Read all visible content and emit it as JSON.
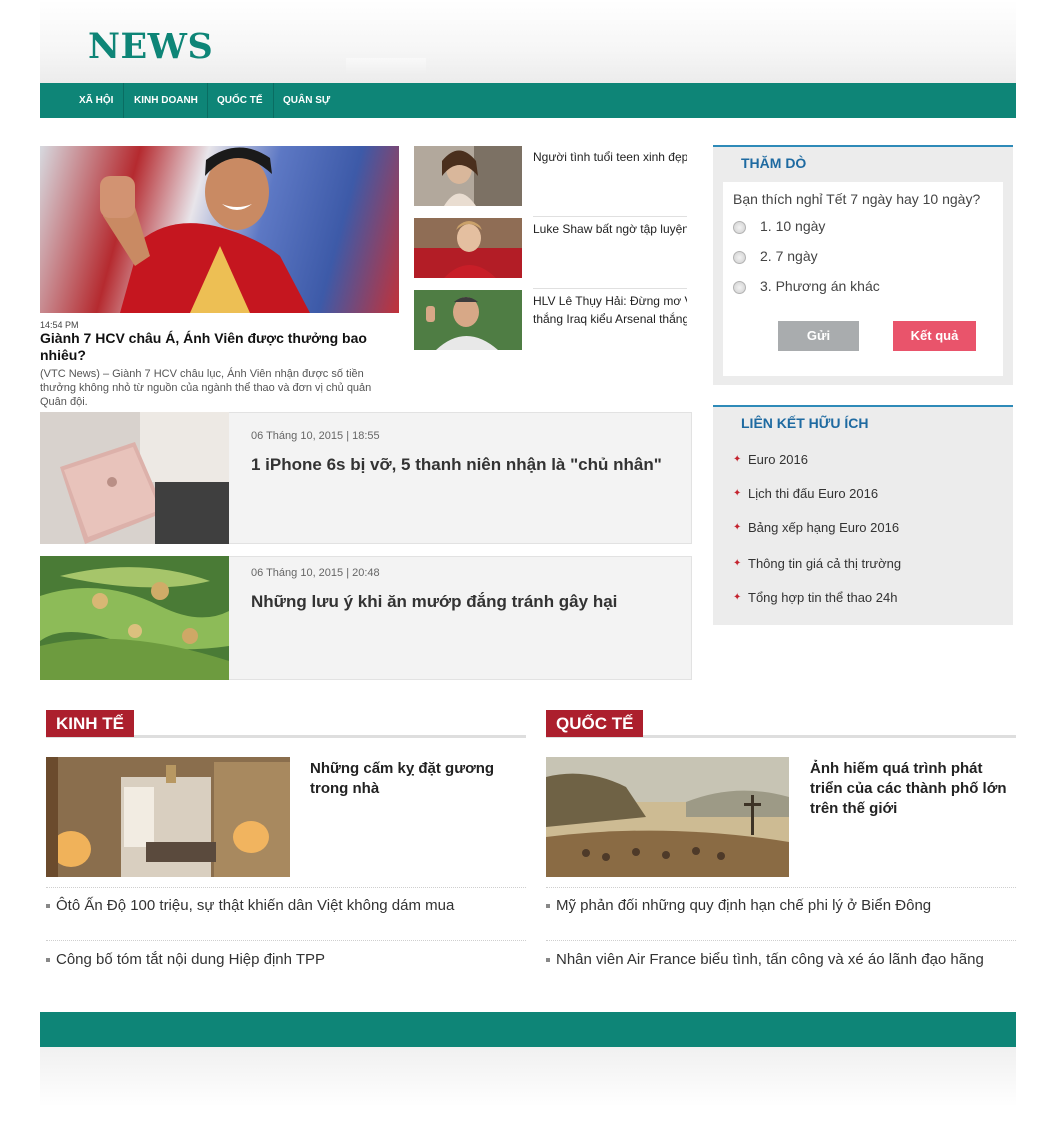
{
  "header": {
    "logo": "NEWS"
  },
  "nav": {
    "items": [
      "Xã hội",
      "Kinh doanh",
      "Quốc tế",
      "Quân sự"
    ]
  },
  "featured": {
    "time": "14:54 PM",
    "title": "Giành 7 HCV châu Á, Ánh Viên được thưởng bao nhiêu?",
    "description": "(VTC News) – Giành 7 HCV châu lục, Ánh Viên nhận được số tiền thưởng không nhỏ từ nguồn của ngành thể thao và đơn vị chủ quản Quân đội."
  },
  "side_stories": [
    {
      "title": "Người tình tuổi teen xinh đẹp"
    },
    {
      "title": "Luke Shaw bất ngờ tập luyện"
    },
    {
      "title": "HLV Lê Thụy Hải: Đừng mơ V",
      "title2": "thắng Iraq kiểu Arsenal thắng"
    }
  ],
  "list_cards": [
    {
      "meta": "06 Tháng 10, 2015 | 18:55",
      "title": "1 iPhone 6s bị vỡ, 5 thanh niên nhận là \"chủ nhân\""
    },
    {
      "meta": "06 Tháng 10, 2015 | 20:48",
      "title": "Những lưu ý khi ăn mướp đắng tránh gây hại"
    }
  ],
  "poll": {
    "heading": "Thăm dò",
    "question": "Bạn thích nghỉ Tết 7 ngày hay 10 ngày?",
    "options": [
      "1. 10 ngày",
      "2. 7 ngày",
      "3. Phương án khác"
    ],
    "submit_label": "Gửi",
    "result_label": "Kết quả"
  },
  "links": {
    "heading": "Liên kết hữu ích",
    "items": [
      "Euro 2016",
      "Lịch thi đấu Euro 2016",
      "Bảng xếp hạng Euro 2016",
      "Thông tin giá cả thị trường",
      "Tổng hợp tin thể thao 24h"
    ]
  },
  "sections": [
    {
      "tag": "Kinh tế",
      "lead_title": "Những cấm kỵ đặt gương trong nhà",
      "items": [
        "Ôtô Ấn Độ 100 triệu, sự thật khiến dân Việt không dám mua",
        "Công bố tóm tắt nội dung Hiệp định TPP"
      ]
    },
    {
      "tag": "Quốc tế",
      "lead_title": "Ảnh hiếm quá trình phát triển của các thành phố lớn trên thế giới",
      "items": [
        "Mỹ phản đối những quy định hạn chế phi lý ở Biển Đông",
        "Nhân viên Air France biểu tình, tấn công và xé áo lãnh đạo hãng"
      ]
    }
  ],
  "colors": {
    "brand": "#0e8577",
    "section_tag": "#ac1f2d",
    "box_accent": "#2e8ab8",
    "result_button": "#e9546b",
    "send_button": "#a9acae"
  },
  "icons": [
    "radio-icon",
    "bullet-icon",
    "square-bullet-icon"
  ]
}
